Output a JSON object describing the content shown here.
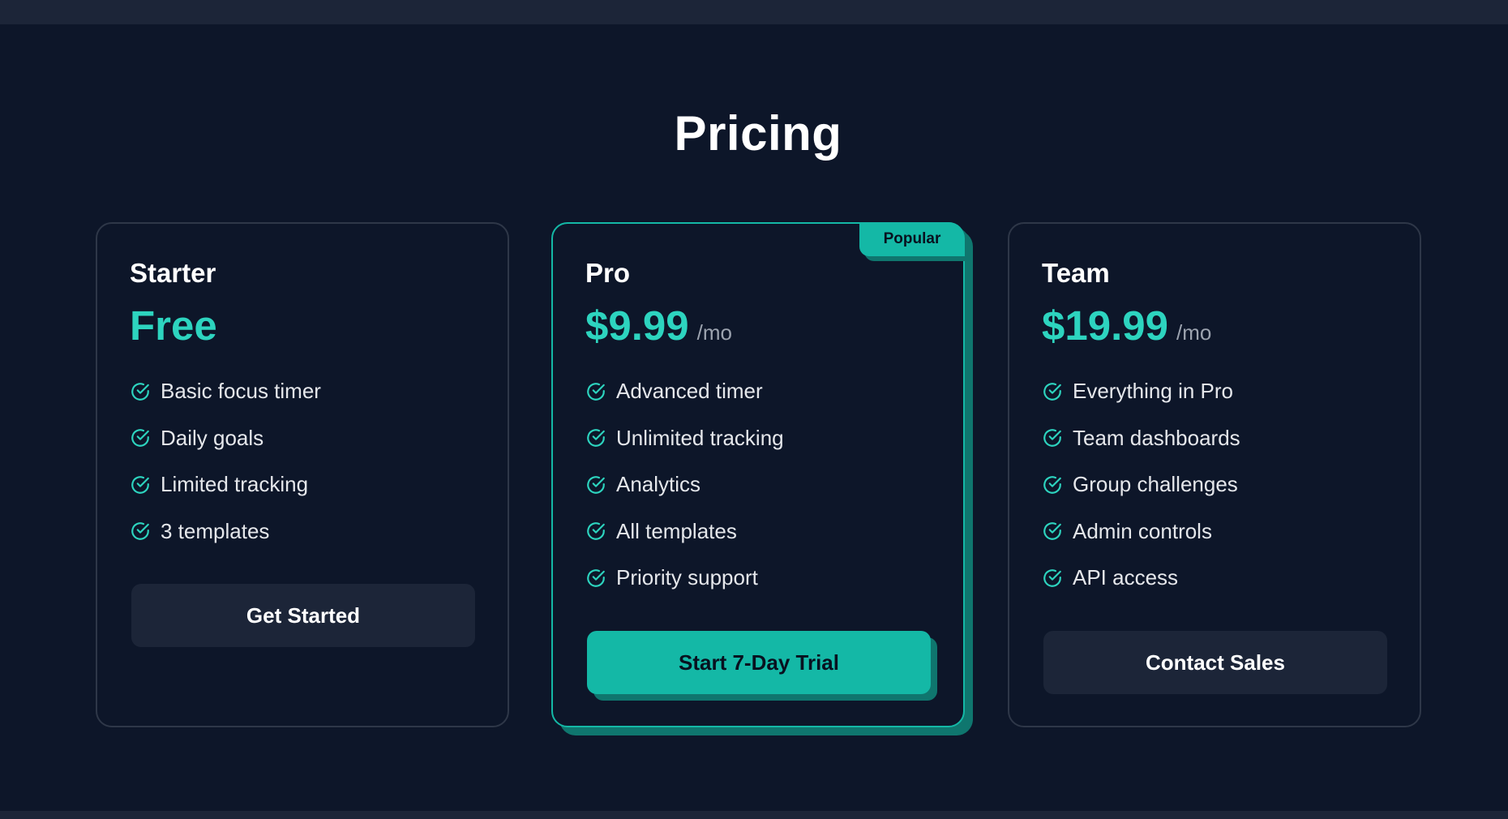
{
  "page": {
    "title": "Pricing"
  },
  "colors": {
    "background": "#0d1629",
    "accent": "#14b8a6",
    "accent_text": "#2dd4bf",
    "accent_shadow": "#0f766e",
    "card_border": "#2e3748",
    "button_dark": "#1c2538"
  },
  "plans": [
    {
      "name": "Starter",
      "price": "Free",
      "period": "",
      "features": [
        "Basic focus timer",
        "Daily goals",
        "Limited tracking",
        "3 templates"
      ],
      "button_label": "Get Started"
    },
    {
      "name": "Pro",
      "badge": "Popular",
      "price": "$9.99",
      "period": "/mo",
      "features": [
        "Advanced timer",
        "Unlimited tracking",
        "Analytics",
        "All templates",
        "Priority support"
      ],
      "button_label": "Start 7-Day Trial"
    },
    {
      "name": "Team",
      "price": "$19.99",
      "period": "/mo",
      "features": [
        "Everything in Pro",
        "Team dashboards",
        "Group challenges",
        "Admin controls",
        "API access"
      ],
      "button_label": "Contact Sales"
    }
  ],
  "icons": {
    "feature_check": "check-circle-icon"
  }
}
